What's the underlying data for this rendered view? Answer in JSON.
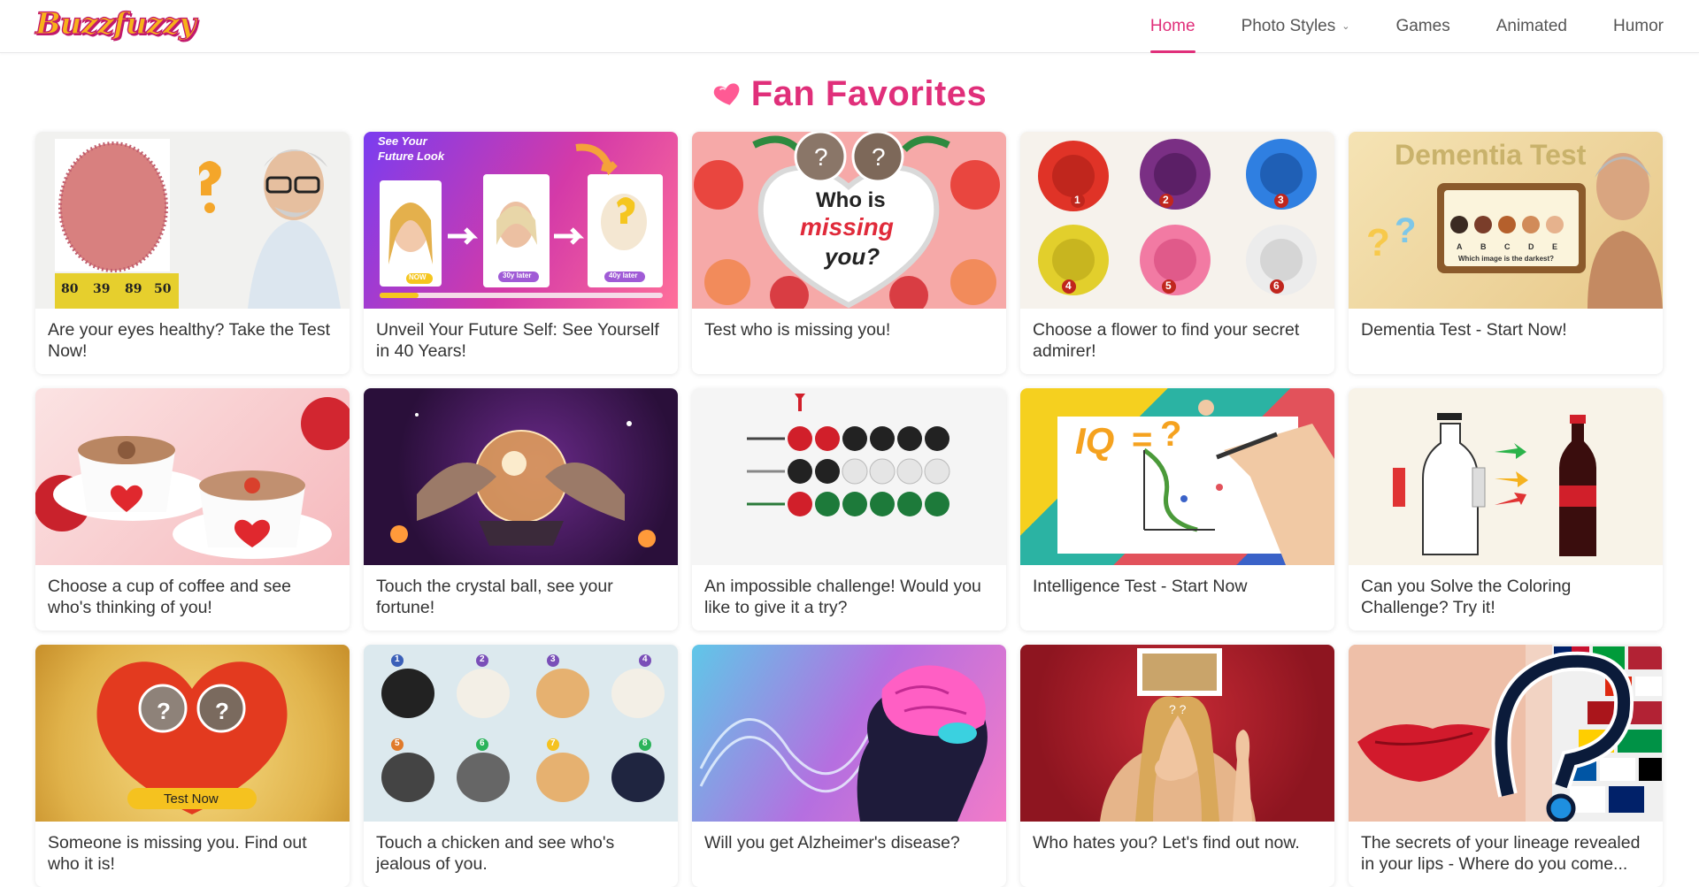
{
  "brand": {
    "logo_text": "Buzzfuzzy"
  },
  "nav": {
    "items": [
      {
        "label": "Home",
        "active": true
      },
      {
        "label": "Photo Styles",
        "has_dropdown": true
      },
      {
        "label": "Games"
      },
      {
        "label": "Animated"
      },
      {
        "label": "Humor"
      }
    ]
  },
  "section": {
    "title": "Fan Favorites",
    "accent_color": "#e02f7a"
  },
  "cards": [
    {
      "title": "Are your eyes healthy? Take the Test Now!",
      "thumb_text": [
        "80",
        "39",
        "89",
        "50"
      ]
    },
    {
      "title": "Unveil Your Future Self: See Yourself in 40 Years!",
      "thumb_text": [
        "See Your",
        "Future Look",
        "NOW",
        "30y later",
        "40y later"
      ]
    },
    {
      "title": "Test who is missing you!",
      "thumb_text": [
        "Who is",
        "missing",
        "you?"
      ]
    },
    {
      "title": "Choose a flower to find your secret admirer!",
      "thumb_text": [
        "1",
        "2",
        "3",
        "4",
        "5",
        "6"
      ]
    },
    {
      "title": "Dementia Test - Start Now!",
      "thumb_text": [
        "Dementia Test",
        "A",
        "B",
        "C",
        "D",
        "E",
        "Which image is the darkest?"
      ]
    },
    {
      "title": "Choose a cup of coffee and see who's thinking of you!",
      "thumb_text": []
    },
    {
      "title": "Touch the crystal ball, see your fortune!",
      "thumb_text": []
    },
    {
      "title": "An impossible challenge! Would you like to give it a try?",
      "thumb_text": []
    },
    {
      "title": "Intelligence Test - Start Now",
      "thumb_text": [
        "IQ",
        "=",
        "?"
      ]
    },
    {
      "title": "Can you Solve the Coloring Challenge? Try it!",
      "thumb_text": []
    },
    {
      "title": "Someone is missing you. Find out who it is!",
      "thumb_text": [
        "?",
        "?",
        "Test Now"
      ]
    },
    {
      "title": "Touch a chicken and see who's jealous of you.",
      "thumb_text": [
        "1",
        "2",
        "3",
        "4",
        "5",
        "6",
        "7",
        "8"
      ]
    },
    {
      "title": "Will you get Alzheimer's disease?",
      "thumb_text": []
    },
    {
      "title": "Who hates you? Let's find out now.",
      "thumb_text": []
    },
    {
      "title": "The secrets of your lineage revealed in your lips - Where do you come...",
      "thumb_text": [
        "?"
      ]
    }
  ]
}
